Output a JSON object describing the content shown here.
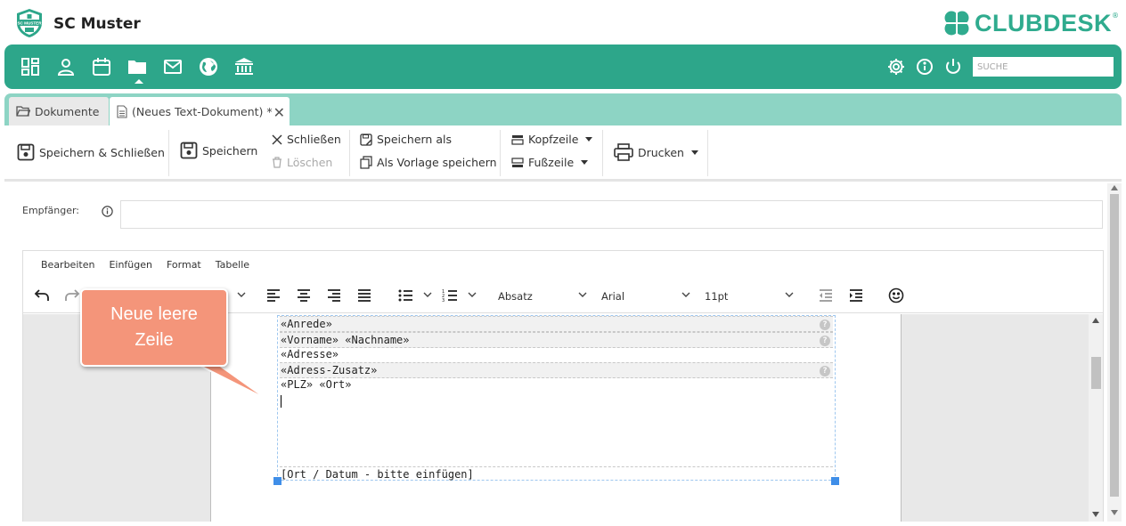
{
  "header": {
    "badge_text": "SC MUSTER",
    "club_name": "SC Muster",
    "brand": "CLUBDESK",
    "brand_reg": "®"
  },
  "nav": {
    "items": [
      {
        "icon": "dashboard-icon"
      },
      {
        "icon": "person-icon"
      },
      {
        "icon": "calendar-icon"
      },
      {
        "icon": "folder-icon",
        "active": true
      },
      {
        "icon": "mail-icon"
      },
      {
        "icon": "globe-icon"
      },
      {
        "icon": "bank-icon"
      }
    ],
    "right_icons": [
      "gear-icon",
      "info-icon",
      "power-icon"
    ],
    "search_placeholder": "SUCHE",
    "accent_color": "#2da68a"
  },
  "tabs": {
    "items": [
      {
        "label": "Dokumente"
      },
      {
        "label": "(Neues Text-Dokument) *"
      }
    ],
    "close": "✕"
  },
  "toolbar": {
    "save_close": "Speichern & Schließen",
    "save": "Speichern",
    "close": "Schließen",
    "delete": "Löschen",
    "save_as": "Speichern als",
    "save_template": "Als Vorlage speichern",
    "header_line": "Kopfzeile",
    "footer_line": "Fußzeile",
    "print": "Drucken"
  },
  "recipient": {
    "label": "Empfänger:",
    "value": ""
  },
  "editor": {
    "menu": [
      "Bearbeiten",
      "Einfügen",
      "Format",
      "Tabelle"
    ],
    "block_format": "Absatz",
    "font": "Arial",
    "font_size": "11pt",
    "fields": [
      {
        "text": "«Anrede»",
        "highlight": true
      },
      {
        "text": "«Vorname» «Nachname»",
        "highlight": true
      },
      {
        "text": "«Adresse»",
        "highlight": false
      },
      {
        "text": "«Adress-Zusatz»",
        "highlight": true
      },
      {
        "text": "«PLZ» «Ort»",
        "highlight": false
      }
    ],
    "date_field": "[Ort / Datum - bitte einfügen]"
  },
  "callout": {
    "line1": "Neue leere",
    "line2": "Zeile"
  }
}
